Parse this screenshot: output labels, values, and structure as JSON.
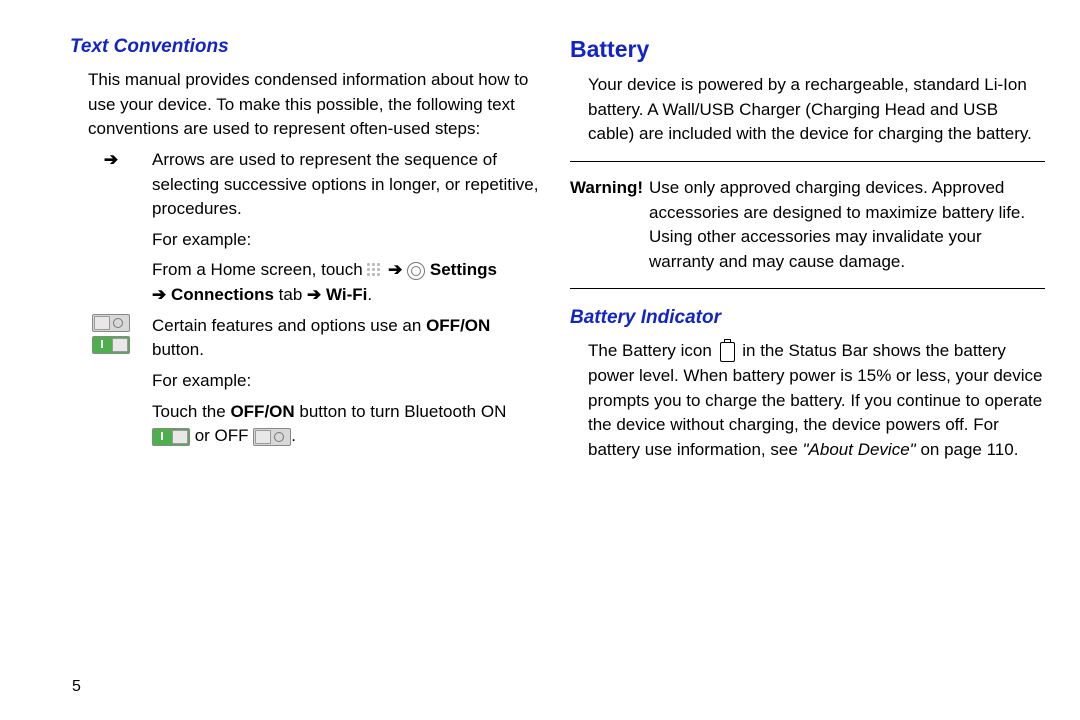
{
  "page_number": "5",
  "left": {
    "heading": "Text Conventions",
    "intro": "This manual provides condensed information about how to use your device. To make this possible, the following text conventions are used to represent often-used steps:",
    "arrow_def": "Arrows are used to represent the sequence of selecting successive options in longer, or repetitive, procedures.",
    "for_example": "For example:",
    "arrow_ex_prefix": "From a Home screen, touch ",
    "arrow": "➔",
    "settings_bold": " Settings",
    "connections_bold": " Connections",
    "tab_text": " tab ",
    "wifi_bold": " Wi-Fi",
    "period": ".",
    "toggle_def_a": "Certain features and options use an ",
    "offon": "OFF/ON",
    "toggle_def_b": " button.",
    "toggle_ex_a": "Touch the ",
    "toggle_ex_b": " button to turn Bluetooth ON ",
    "or": " or OFF "
  },
  "right": {
    "h1": "Battery",
    "intro": "Your device is powered by a rechargeable, standard Li-Ion battery. A Wall/USB Charger (Charging Head and USB cable) are included with the device for charging the battery.",
    "warning_label": "Warning!",
    "warning_body": " Use only approved charging devices. Approved accessories are designed to maximize battery life. Using other accessories may invalidate your warranty and may cause damage.",
    "h2": "Battery Indicator",
    "indicator_a": "The Battery icon ",
    "indicator_b": " in the Status Bar shows the battery power level. When battery power is 15% or less, your device prompts you to charge the battery. If you continue to operate the device without charging, the device powers off. For battery use information, see ",
    "crossref": "\"About Device\"",
    "crossref_tail": " on page 110."
  }
}
